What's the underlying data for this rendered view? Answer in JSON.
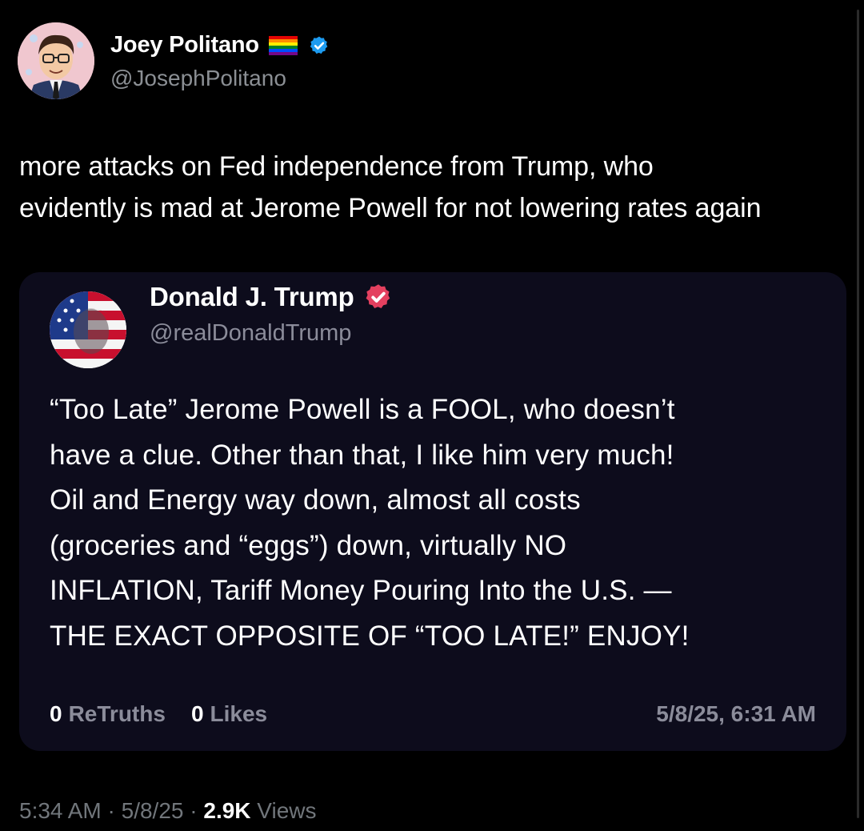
{
  "author": {
    "display_name": "Joey Politano",
    "handle": "@JosephPolitano",
    "verified_color": "#1d9bf0",
    "flag_colors": [
      "#e40303",
      "#ff8c00",
      "#ffed00",
      "#008026",
      "#004dff",
      "#750787"
    ]
  },
  "tweet": {
    "text": "more attacks on Fed independence from Trump, who\nevidently is mad at Jerome Powell for not lowering rates again"
  },
  "quoted_post": {
    "display_name": "Donald J. Trump",
    "handle": "@realDonaldTrump",
    "badge_color": "#e4405f",
    "text": "“Too Late” Jerome Powell is a FOOL, who doesn’t\nhave a clue. Other than that, I like him very much!\nOil and Energy way down, almost all costs\n(groceries and “eggs”) down, virtually NO\nINFLATION, Tariff Money Pouring Into the U.S. —\nTHE EXACT OPPOSITE OF “TOO LATE!” ENJOY!",
    "retruths_count": "0",
    "retruths_label": "ReTruths",
    "likes_count": "0",
    "likes_label": "Likes",
    "date": "5/8/25, 6:31 AM"
  },
  "meta": {
    "time": "5:34 AM",
    "separator": " · ",
    "date": "5/8/25",
    "views_count": "2.9K",
    "views_label": " Views"
  }
}
